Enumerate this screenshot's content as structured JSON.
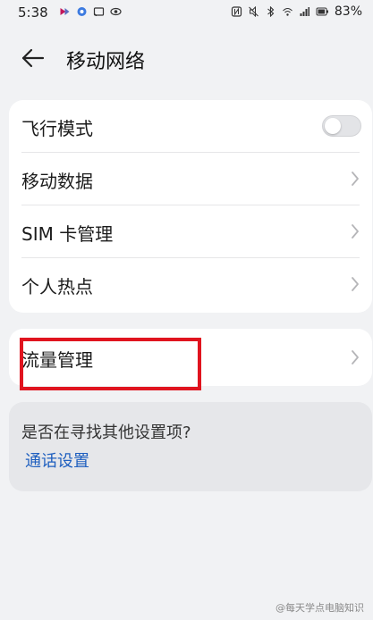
{
  "status_bar": {
    "time": "5:38",
    "battery": "83%",
    "left_icons": [
      "notification-icon",
      "message-icon",
      "cast-icon",
      "eye-icon"
    ],
    "right_icons": [
      "nfc-icon",
      "mute-icon",
      "bluetooth-icon",
      "wifi-icon",
      "signal-icon",
      "battery-icon"
    ]
  },
  "header": {
    "title": "移动网络",
    "back_icon": "arrow-left-icon"
  },
  "settings_group1": {
    "items": [
      {
        "label": "飞行模式",
        "control": "toggle",
        "state": "off"
      },
      {
        "label": "移动数据",
        "control": "chevron"
      },
      {
        "label": "SIM 卡管理",
        "control": "chevron"
      },
      {
        "label": "个人热点",
        "control": "chevron"
      }
    ]
  },
  "settings_group2": {
    "items": [
      {
        "label": "流量管理",
        "control": "chevron"
      }
    ]
  },
  "suggestion": {
    "question": "是否在寻找其他设置项?",
    "link": "通话设置"
  },
  "annotation": {
    "color": "#e0141f"
  },
  "colors": {
    "accent_link": "#1f5fbf",
    "background": "#f1f2f4"
  },
  "watermark": "@每天学点电脑知识"
}
